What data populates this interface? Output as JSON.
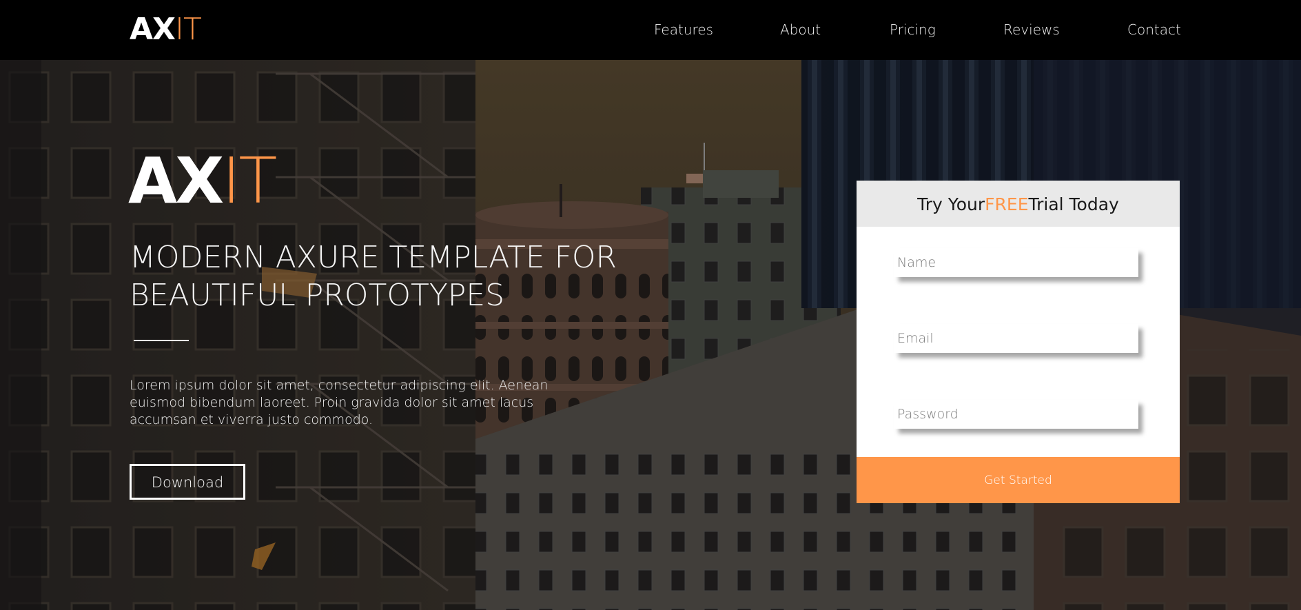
{
  "brand": {
    "logo_part_1": "AX",
    "logo_part_2": "IT",
    "accent_color": "#ff9649"
  },
  "nav": {
    "items": [
      {
        "label": "Features"
      },
      {
        "label": "About"
      },
      {
        "label": "Pricing"
      },
      {
        "label": "Reviews"
      },
      {
        "label": "Contact"
      }
    ]
  },
  "hero": {
    "logo_part_1": "AX",
    "logo_part_2": "IT",
    "headline": "MODERN AXURE TEMPLATE FOR BEAUTIFUL PROTOTYPES",
    "body": "Lorem ipsum dolor sit amet, consectetur adipiscing elit. Aenean euismod bibendum laoreet. Proin gravida dolor sit amet lacus accumsan et viverra justo commodo.",
    "download_label": "Download",
    "background": "city-buildings-photo"
  },
  "signup": {
    "title_before": "Try Your",
    "title_highlight": "FREE",
    "title_after": "Trial Today",
    "name_placeholder": "Name",
    "email_placeholder": "Email",
    "password_placeholder": "Password",
    "submit_label": "Get Started",
    "header_bg": "#e9e9e9",
    "button_bg": "#ff9649"
  }
}
